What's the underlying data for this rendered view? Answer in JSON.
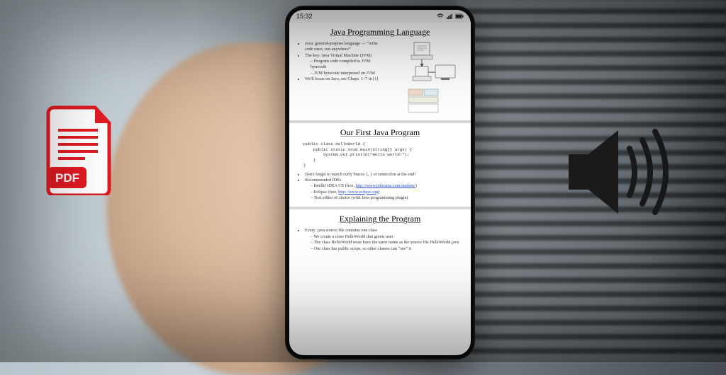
{
  "icons": {
    "pdf_label": "PDF"
  },
  "status": {
    "time": "15:32"
  },
  "slides": {
    "s1": {
      "title": "Java Programming Language",
      "b1": "Java: general-purpose language — “write code once, run anywhere”",
      "b2": "The key: Java Virtual Machine (JVM)",
      "b2a": "Program code compiled to JVM bytecode",
      "b2b": "JVM bytecode interpreted on JVM",
      "b3": "We'll focus on Java, see Chaps. 1–7 in [1]"
    },
    "s2": {
      "title": "Our First Java Program",
      "code": "public class HelloWorld {\n    public static void main(String[] args) {\n        System.out.println(\"Hello world!\");\n    }\n}",
      "b1": "Don't forget to match curly braces {, } or semicolon at the end!",
      "b2": "Recommended IDEs",
      "b2a_pre": "IntelliJ IDEA CE (free, ",
      "b2a_link": "http://www.jetbrains.com/student/",
      "b2a_post": ")",
      "b2b_pre": "Eclipse (free, ",
      "b2b_link": "http://www.eclipse.org",
      "b2b_post": ")",
      "b2c": "Text editor of choice (with Java programming plugin)"
    },
    "s3": {
      "title": "Explaining the Program",
      "b1": "Every .java source file contains one class",
      "b1a": "We create a class HelloWorld that greets user",
      "b1b": "The class HelloWorld must have the same name as the source file HelloWorld.java",
      "b1c": "Our class has public scope, so other classes can “see” it"
    }
  }
}
